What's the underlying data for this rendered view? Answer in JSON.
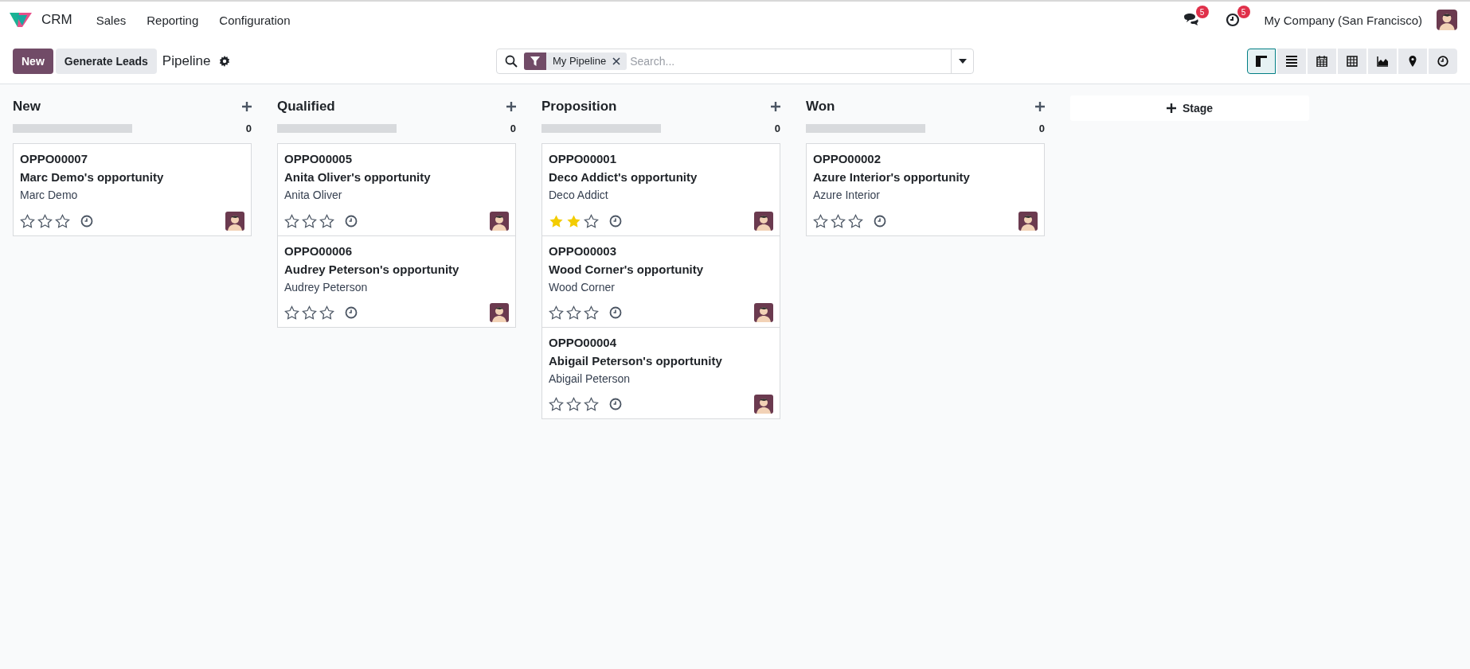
{
  "navbar": {
    "app": "CRM",
    "menus": [
      "Sales",
      "Reporting",
      "Configuration"
    ],
    "messages_badge": "5",
    "activities_badge": "5",
    "company": "My Company (San Francisco)"
  },
  "control_panel": {
    "buttons": [
      {
        "label": "New",
        "kind": "primary"
      },
      {
        "label": "Generate Leads",
        "kind": "secondary"
      }
    ],
    "breadcrumb": "Pipeline",
    "search": {
      "facet": "My Pipeline",
      "placeholder": "Search..."
    },
    "views": [
      {
        "kind": "kanban",
        "selected": true
      },
      {
        "kind": "list",
        "selected": false
      },
      {
        "kind": "calendar",
        "selected": false
      },
      {
        "kind": "pivot",
        "selected": false
      },
      {
        "kind": "graph",
        "selected": false
      },
      {
        "kind": "map",
        "selected": false
      },
      {
        "kind": "activity",
        "selected": false
      }
    ]
  },
  "columns": [
    {
      "title": "New",
      "count": "0",
      "level": 0,
      "cards": [
        {
          "ref": "OPPO00007",
          "name": "Marc Demo's opportunity",
          "customer": "Marc Demo",
          "stars": 0
        }
      ]
    },
    {
      "title": "Qualified",
      "count": "0",
      "level": 0,
      "cards": [
        {
          "ref": "OPPO00005",
          "name": "Anita Oliver's opportunity",
          "customer": "Anita Oliver",
          "stars": 0
        },
        {
          "ref": "OPPO00006",
          "name": "Audrey Peterson's opportunity",
          "customer": "Audrey Peterson",
          "stars": 0
        }
      ]
    },
    {
      "title": "Proposition",
      "count": "0",
      "level": 0,
      "cards": [
        {
          "ref": "OPPO00001",
          "name": "Deco Addict's opportunity",
          "customer": "Deco Addict",
          "stars": 2
        },
        {
          "ref": "OPPO00003",
          "name": "Wood Corner's opportunity",
          "customer": "Wood Corner",
          "stars": 0
        },
        {
          "ref": "OPPO00004",
          "name": "Abigail Peterson's opportunity",
          "customer": "Abigail Peterson",
          "stars": 0
        }
      ]
    },
    {
      "title": "Won",
      "count": "0",
      "level": 0,
      "cards": [
        {
          "ref": "OPPO00002",
          "name": "Azure Interior's opportunity",
          "customer": "Azure Interior",
          "stars": 0
        }
      ]
    }
  ],
  "add_stage": "Stage"
}
